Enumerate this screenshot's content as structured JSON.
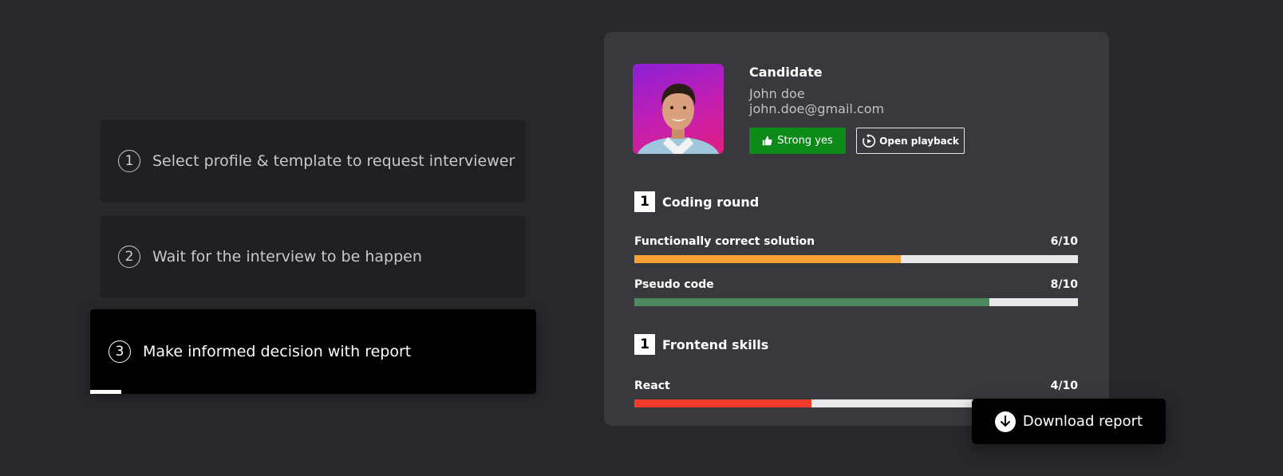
{
  "steps": [
    {
      "number": "1",
      "label": "Select profile & template to request interviewer"
    },
    {
      "number": "2",
      "label": "Wait for the interview to be happen"
    },
    {
      "number": "3",
      "label": "Make informed decision with report"
    }
  ],
  "active_step_progress_percent": 7,
  "candidate": {
    "heading": "Candidate",
    "name": "John doe",
    "email": "john.doe@gmail.com",
    "avatar_icon": "candidate-photo"
  },
  "buttons": {
    "strong_yes": "Strong yes",
    "strong_yes_icon": "thumbs-up-icon",
    "open_playback": "Open playback",
    "open_playback_icon": "replay-icon",
    "download_report": "Download report",
    "download_icon": "download-arrow-icon"
  },
  "sections": [
    {
      "number": "1",
      "title": "Coding round",
      "metrics": [
        {
          "label": "Functionally correct solution",
          "score_text": "6/10",
          "score": 6,
          "max": 10,
          "color": "#f7a134"
        },
        {
          "label": "Pseudo code",
          "score_text": "8/10",
          "score": 8,
          "max": 10,
          "color": "#4d8a5e"
        }
      ]
    },
    {
      "number": "1",
      "title": "Frontend skills",
      "metrics": [
        {
          "label": "React",
          "score_text": "4/10",
          "score": 4,
          "max": 10,
          "color": "#f23c2b"
        }
      ]
    }
  ],
  "colors": {
    "background": "#27282c",
    "card": "#38393d",
    "strong_yes": "#0e8a1a",
    "bar_track": "#e9e9e9"
  }
}
